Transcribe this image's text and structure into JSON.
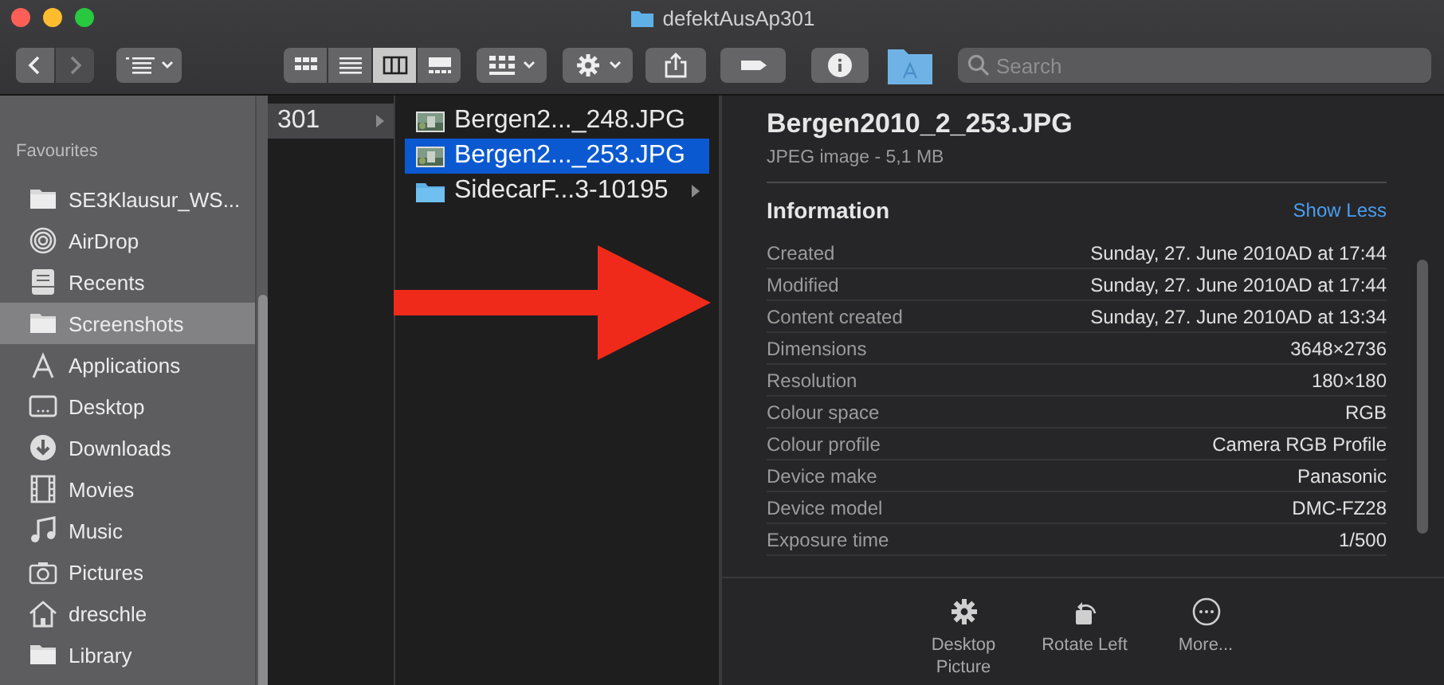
{
  "window": {
    "title": "defektAusAp301"
  },
  "toolbar": {
    "view_modes": [
      {
        "kind": "icons",
        "selected": false
      },
      {
        "kind": "list",
        "selected": false
      },
      {
        "kind": "columns",
        "selected": true
      },
      {
        "kind": "gallery",
        "selected": false
      }
    ],
    "search": {
      "placeholder": "Search"
    }
  },
  "sidebar": {
    "section": "Favourites",
    "items": [
      {
        "label": "SE3Klausur_WS...",
        "kind": "folder",
        "selected": false
      },
      {
        "label": "AirDrop",
        "kind": "airdrop",
        "selected": false
      },
      {
        "label": "Recents",
        "kind": "recents",
        "selected": false
      },
      {
        "label": "Screenshots",
        "kind": "folder",
        "selected": true
      },
      {
        "label": "Applications",
        "kind": "applications",
        "selected": false
      },
      {
        "label": "Desktop",
        "kind": "desktop",
        "selected": false
      },
      {
        "label": "Downloads",
        "kind": "downloads",
        "selected": false
      },
      {
        "label": "Movies",
        "kind": "movies",
        "selected": false
      },
      {
        "label": "Music",
        "kind": "music",
        "selected": false
      },
      {
        "label": "Pictures",
        "kind": "pictures",
        "selected": false
      },
      {
        "label": "dreschle",
        "kind": "home",
        "selected": false
      },
      {
        "label": "Library",
        "kind": "folder",
        "selected": false
      }
    ]
  },
  "columns": [
    {
      "active": false,
      "items": [
        {
          "name": "301",
          "kind": "plain",
          "has_children": true,
          "selected": true
        }
      ]
    },
    {
      "active": true,
      "items": [
        {
          "name": "Bergen2..._248.JPG",
          "has_children": false,
          "selected": false
        },
        {
          "name": "Bergen2..._253.JPG",
          "has_children": false,
          "selected": true
        },
        {
          "name": "SidecarF...3-10195",
          "kind": "folder",
          "has_children": true,
          "selected": false
        }
      ]
    }
  ],
  "preview": {
    "title": "Bergen2010_2_253.JPG",
    "subtitle": "JPEG image - 5,1 MB",
    "section": "Information",
    "toggle": "Show Less",
    "rows": [
      {
        "label": "Created",
        "value": "Sunday, 27. June 2010AD at 17:44"
      },
      {
        "label": "Modified",
        "value": "Sunday, 27. June 2010AD at 17:44"
      },
      {
        "label": "Content created",
        "value": "Sunday, 27. June 2010AD at 13:34"
      },
      {
        "label": "Dimensions",
        "value": "3648×2736"
      },
      {
        "label": "Resolution",
        "value": "180×180"
      },
      {
        "label": "Colour space",
        "value": "RGB"
      },
      {
        "label": "Colour profile",
        "value": "Camera RGB Profile"
      },
      {
        "label": "Device make",
        "value": "Panasonic"
      },
      {
        "label": "Device model",
        "value": "DMC-FZ28"
      },
      {
        "label": "Exposure time",
        "value": "1/500"
      }
    ],
    "actions": [
      {
        "label": "Desktop Picture",
        "kind": "gear"
      },
      {
        "label": "Rotate Left",
        "kind": "rotate"
      },
      {
        "label": "More...",
        "kind": "more"
      }
    ]
  }
}
